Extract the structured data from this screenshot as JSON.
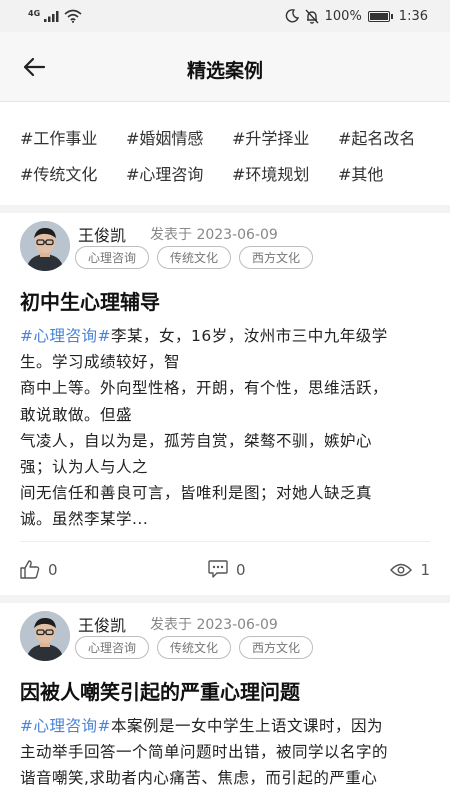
{
  "status_bar": {
    "network": "4G",
    "battery": "100%",
    "time": "1:36"
  },
  "header": {
    "title": "精选案例"
  },
  "tags": [
    [
      "#工作事业",
      "#婚姻情感",
      "#升学择业",
      "#起名改名"
    ],
    [
      "#传统文化",
      "#心理咨询",
      "#环境规划",
      "#其他"
    ]
  ],
  "cards": [
    {
      "author": "王俊凯",
      "date": "发表于 2023-06-09",
      "chips": [
        "心理咨询",
        "传统文化",
        "西方文化"
      ],
      "title": "初中生心理辅导",
      "topic": "#心理咨询#",
      "lines": [
        "李某，女，16岁，汝州市三中九年级学",
        "生。学习成绩较好，智",
        "商中上等。外向型性格，开朗，有个性，思维活跃，",
        "敢说敢做。但盛",
        "气凌人，自以为是，孤芳自赏，桀骜不驯，嫉妒心",
        "强；认为人与人之",
        "间无信任和善良可言，皆唯利是图；对她人缺乏真",
        "诚。虽然李某学..."
      ],
      "likes": "0",
      "comments": "0",
      "views": "1"
    },
    {
      "author": "王俊凯",
      "date": "发表于 2023-06-09",
      "chips": [
        "心理咨询",
        "传统文化",
        "西方文化"
      ],
      "title": "因被人嘲笑引起的严重心理问题",
      "topic": "#心理咨询#",
      "lines": [
        "本案例是一女中学生上语文课时，因为",
        "主动举手回答一个简单问题时出错，被同学以名字的",
        "谐音嘲笑,求助者内心痛苦、焦虑，而引起的严重心"
      ]
    }
  ]
}
